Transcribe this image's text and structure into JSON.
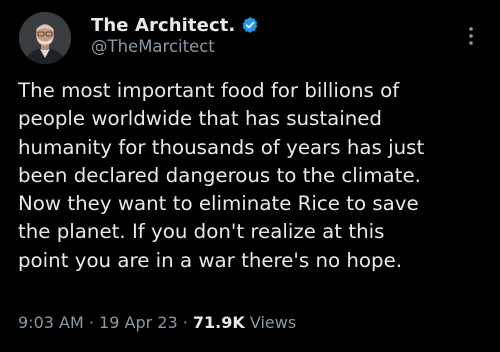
{
  "author": {
    "display_name": "The Architect.",
    "handle": "@TheMarcitect",
    "verified": true,
    "avatar": "avatar-photo"
  },
  "tweet": {
    "lines": [
      "The most important food for billions of",
      "people worldwide that has sustained",
      "humanity for thousands of years has just",
      "been declared dangerous to the climate.",
      "Now they want to eliminate Rice to save",
      "the planet. If you don't realize at this",
      "point you are in a war there's no hope."
    ]
  },
  "meta": {
    "time": "9:03 AM",
    "sep1": "·",
    "date": "19 Apr 23",
    "sep2": "·",
    "views_count": "71.9K",
    "views_label": "Views"
  },
  "colors": {
    "background": "#000000",
    "text_primary": "#e7e9ea",
    "text_secondary": "#8b98a5",
    "verified_blue": "#1d9bf0"
  },
  "icons": {
    "verified": "verified-badge-icon",
    "more": "more-options-icon"
  }
}
